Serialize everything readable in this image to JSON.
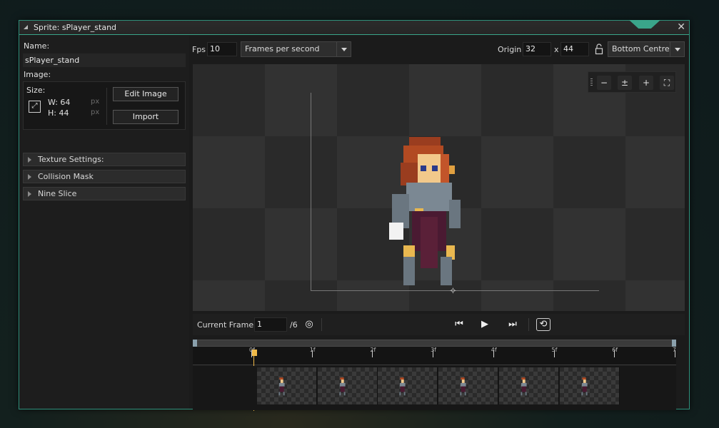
{
  "window": {
    "title": "Sprite: sPlayer_stand",
    "close": "✕"
  },
  "left": {
    "name_label": "Name:",
    "name_value": "sPlayer_stand",
    "image_label": "Image:",
    "size_label": "Size:",
    "width": "W: 64",
    "height": "H: 44",
    "unit": "px",
    "edit_image": "Edit Image",
    "import": "Import",
    "sections": [
      "Texture Settings:",
      "Collision Mask",
      "Nine Slice"
    ]
  },
  "toolbar": {
    "fps_label": "Fps",
    "fps_value": "10",
    "fps_mode": "Frames per second",
    "origin_label": "Origin",
    "origin_x": "32",
    "origin_sep": "x",
    "origin_y": "44",
    "origin_preset": "Bottom Centre"
  },
  "zoom": {
    "zoom_out": "−",
    "zoom_reset": "±",
    "zoom_in": "+",
    "fit": "⛶"
  },
  "playback": {
    "current_frame_label": "Current Frame:",
    "current_frame": "1",
    "total": "/6",
    "onion_icon": "◎",
    "first": "⏮",
    "play": "▶",
    "last": "⏭",
    "loop": "⟲"
  },
  "timeline": {
    "ticks": [
      "0f",
      "1f",
      "2f",
      "3f",
      "4f",
      "5f",
      "6f",
      "7"
    ],
    "frame_count": 6
  },
  "colors": {
    "accent": "#3aa58a",
    "playhead": "#f0b948"
  }
}
